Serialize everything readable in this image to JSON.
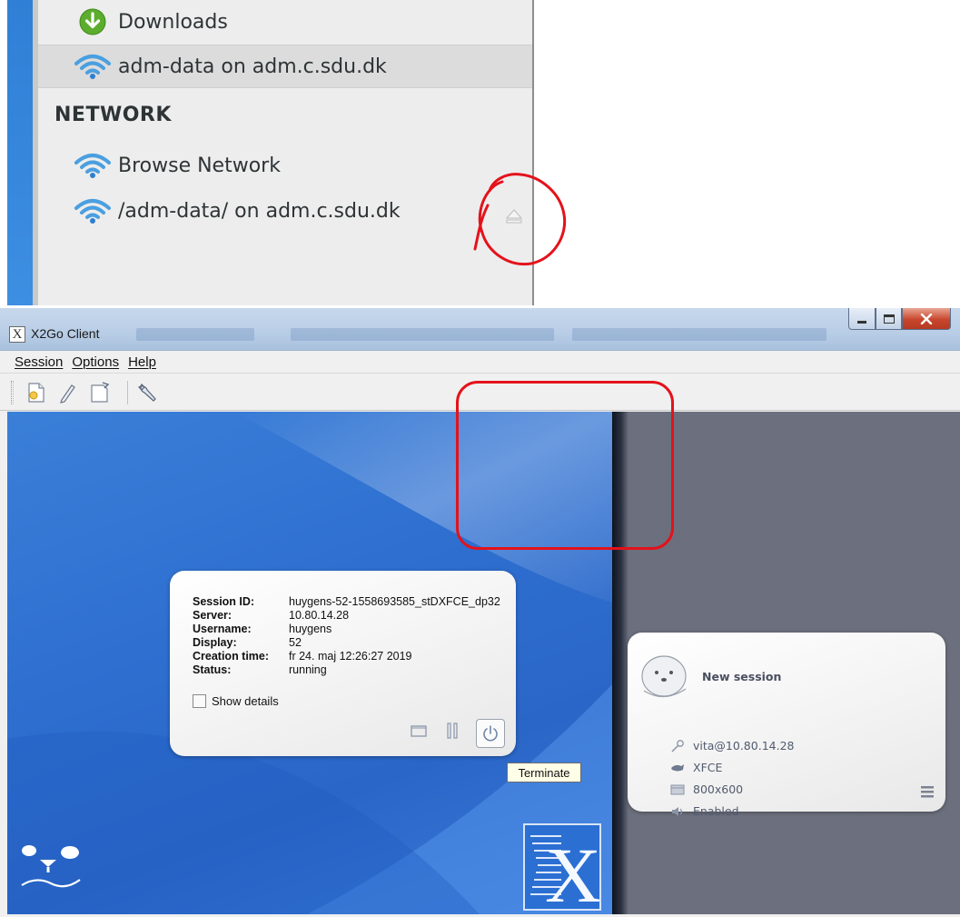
{
  "file_manager": {
    "items": [
      {
        "label": "Downloads",
        "icon": "downloads-icon"
      },
      {
        "label": "adm-data on adm.c.sdu.dk",
        "icon": "network-share-icon"
      }
    ],
    "network_heading": "NETWORK",
    "network_items": [
      {
        "label": "Browse Network",
        "icon": "network-icon"
      },
      {
        "label": "/adm-data/ on adm.c.sdu.dk",
        "icon": "network-share-icon"
      }
    ],
    "eject_icon": "eject-icon"
  },
  "window": {
    "title": "X2Go Client",
    "menu": [
      "Session",
      "Options",
      "Help"
    ],
    "toolbar": [
      "new-session-icon",
      "edit-session-icon",
      "export-session-icon",
      "preferences-icon"
    ]
  },
  "session_card": {
    "labels": {
      "session_id": "Session ID:",
      "server": "Server:",
      "username": "Username:",
      "display": "Display:",
      "creation_time": "Creation time:",
      "status": "Status:"
    },
    "values": {
      "session_id": "huygens-52-1558693585_stDXFCE_dp32",
      "server": "10.80.14.28",
      "username": "huygens",
      "display": "52",
      "creation_time": "fr 24. maj 12:26:27 2019",
      "status": "running"
    },
    "show_details_label": "Show details",
    "tooltip": "Terminate"
  },
  "new_session_card": {
    "title": "New session",
    "server": "vita@10.80.14.28",
    "desktop": "XFCE",
    "resolution": "800x600",
    "sound": "Enabled"
  },
  "colors": {
    "annotation_red": "#e4121b",
    "desktop_blue": "#2e6fd0",
    "side_gray": "#6c6f7d"
  }
}
